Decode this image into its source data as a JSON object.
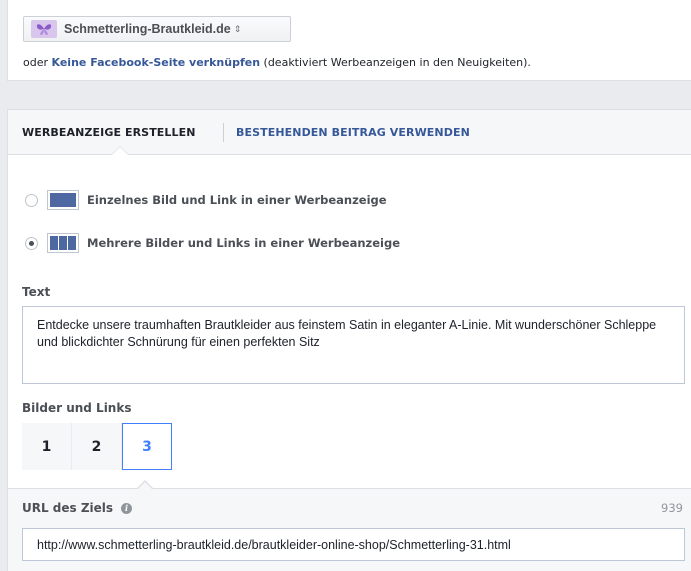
{
  "page_selector": {
    "label": "Schmetterling-Brautkleid.de",
    "arrow": "⇕"
  },
  "facebook_page_line": {
    "prefix": "oder",
    "link": "Keine Facebook-Seite verknüpfen",
    "suffix": "(deaktiviert Werbeanzeigen in den Neuigkeiten)."
  },
  "tabs": {
    "create_ad": "WERBEANZEIGE ERSTELLEN",
    "use_existing_post": "BESTEHENDEN BEITRAG VERWENDEN"
  },
  "format_options": [
    {
      "label": "Einzelnes Bild und Link in einer Werbeanzeige",
      "selected": false
    },
    {
      "label": "Mehrere Bilder und Links in einer Werbeanzeige",
      "selected": true
    }
  ],
  "text_section": {
    "label": "Text",
    "value": "Entdecke unsere traumhaften Brautkleider aus feinstem Satin in eleganter A-Linie.  Mit wunderschöner Schleppe und blickdichter Schnürung für einen perfekten Sitz"
  },
  "images_links": {
    "label": "Bilder und Links",
    "tabs": [
      "1",
      "2",
      "3"
    ],
    "active_index": 2
  },
  "url_section": {
    "label": "URL des Ziels",
    "remaining_chars": "939",
    "value": "http://www.schmetterling-brautkleid.de/brautkleider-online-shop/Schmetterling-31.html"
  },
  "colors": {
    "link": "#365899",
    "active_tab": "#4080ff",
    "icon_fill": "#4e69a2"
  }
}
